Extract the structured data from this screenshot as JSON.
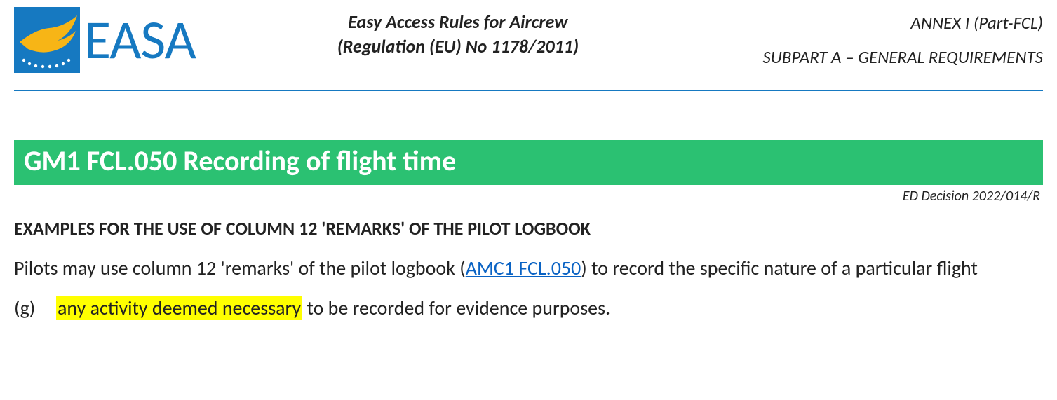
{
  "logo": {
    "text": "EASA"
  },
  "header": {
    "center_line1": "Easy Access Rules for Aircrew",
    "center_line2": "(Regulation (EU) No 1178/2011)",
    "right_line1": "ANNEX I (Part-FCL)",
    "right_line2": "SUBPART A – GENERAL REQUIREMENTS"
  },
  "banner": {
    "title": "GM1 FCL.050 Recording of flight time",
    "ed_decision": "ED Decision 2022/014/R"
  },
  "sub_heading": "EXAMPLES FOR THE USE OF COLUMN 12 'REMARKS' OF THE PILOT LOGBOOK",
  "intro": {
    "pre": "Pilots may use column 12 'remarks' of the pilot logbook (",
    "link_text": "AMC1 FCL.050",
    "post": ") to record the specific nature of a particular flight"
  },
  "item_g": {
    "letter": "(g)",
    "highlight": "any activity deemed necessary",
    "rest": " to be recorded for evidence purposes."
  }
}
